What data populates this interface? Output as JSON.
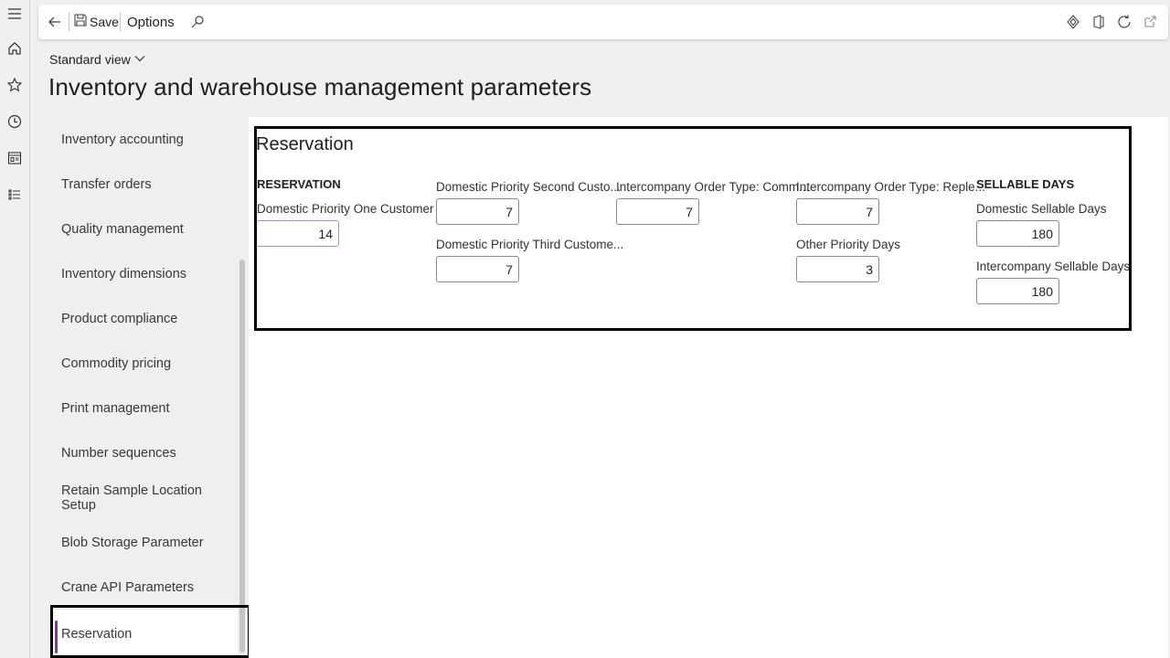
{
  "toolbar": {
    "save_label": "Save",
    "options_label": "Options",
    "icons": [
      "back-arrow-icon",
      "save-icon",
      "search-icon",
      "diamond-icon",
      "office-icon",
      "refresh-icon",
      "open-new-window-icon"
    ]
  },
  "rail": {
    "icons": [
      "hamburger-menu-icon",
      "home-icon",
      "star-icon",
      "clock-icon",
      "workspace-icon",
      "list-icon"
    ]
  },
  "header": {
    "view_label": "Standard view",
    "title": "Inventory and warehouse management parameters"
  },
  "nav": {
    "items": [
      {
        "label": "Inventory accounting"
      },
      {
        "label": "Transfer orders"
      },
      {
        "label": "Quality management"
      },
      {
        "label": "Inventory dimensions"
      },
      {
        "label": "Product compliance"
      },
      {
        "label": "Commodity pricing"
      },
      {
        "label": "Print management"
      },
      {
        "label": "Number sequences"
      },
      {
        "label": "Retain Sample Location Setup"
      },
      {
        "label": "Blob Storage Parameter"
      },
      {
        "label": "Crane API Parameters"
      },
      {
        "label": "Reservation"
      }
    ],
    "active_index": 11,
    "accent_color": "#7a3d88"
  },
  "section": {
    "title": "Reservation",
    "groups": [
      {
        "header": "RESERVATION"
      },
      {
        "header": "SELLABLE DAYS"
      }
    ],
    "fields": [
      {
        "label": "Domestic Priority One Customer ...",
        "value": "14"
      },
      {
        "label": "Domestic Priority Second Custo...",
        "value": "7"
      },
      {
        "label": "Domestic Priority Third Custome...",
        "value": "7"
      },
      {
        "label": "Intercompany Order Type: Comm...",
        "value": "7"
      },
      {
        "label": "Intercompany Order Type: Reple...",
        "value": "7"
      },
      {
        "label": "Other Priority Days",
        "value": "3"
      },
      {
        "label": "Domestic Sellable Days",
        "value": "180"
      },
      {
        "label": "Intercompany Sellable Days",
        "value": "180"
      }
    ]
  }
}
